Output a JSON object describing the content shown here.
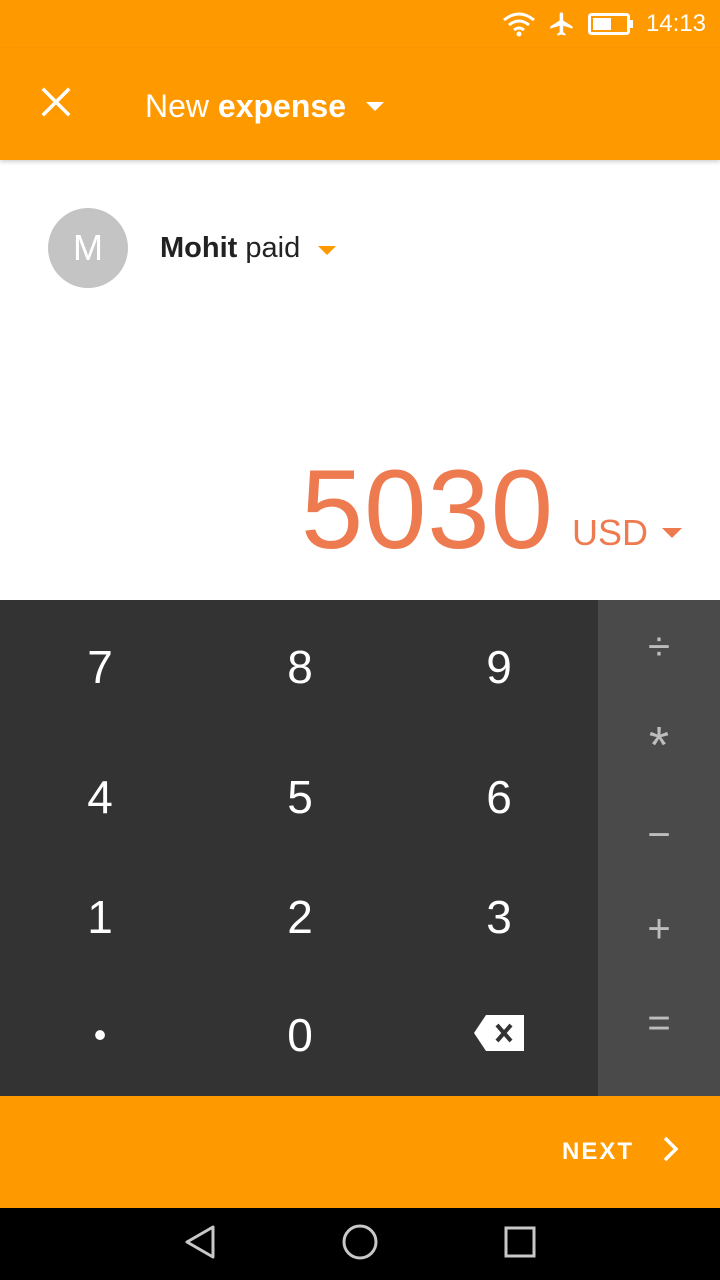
{
  "status_bar": {
    "time": "14:13",
    "icons": [
      "wifi-icon",
      "airplane-icon",
      "battery-icon"
    ]
  },
  "app_bar": {
    "close_icon": "close-icon",
    "title_prefix": "New",
    "title_bold": "expense"
  },
  "payer": {
    "avatar_initial": "M",
    "name": "Mohit",
    "suffix": "paid"
  },
  "amount": {
    "value": "5030",
    "currency": "USD"
  },
  "keypad": {
    "keys": [
      "7",
      "8",
      "9",
      "4",
      "5",
      "6",
      "1",
      "2",
      "3",
      "•",
      "0",
      ""
    ],
    "backspace_icon": "backspace-icon"
  },
  "operators": [
    "÷",
    "*",
    "−",
    "+",
    "="
  ],
  "next": {
    "label": "NEXT",
    "icon": "chevron-right-icon"
  },
  "nav": {
    "icons": [
      "back-icon",
      "home-icon",
      "recents-icon"
    ]
  },
  "colors": {
    "brand": "#FF9900",
    "amount": "#EE7A4F",
    "keypad_bg": "#333333",
    "ops_bg": "#4A4A4A"
  }
}
